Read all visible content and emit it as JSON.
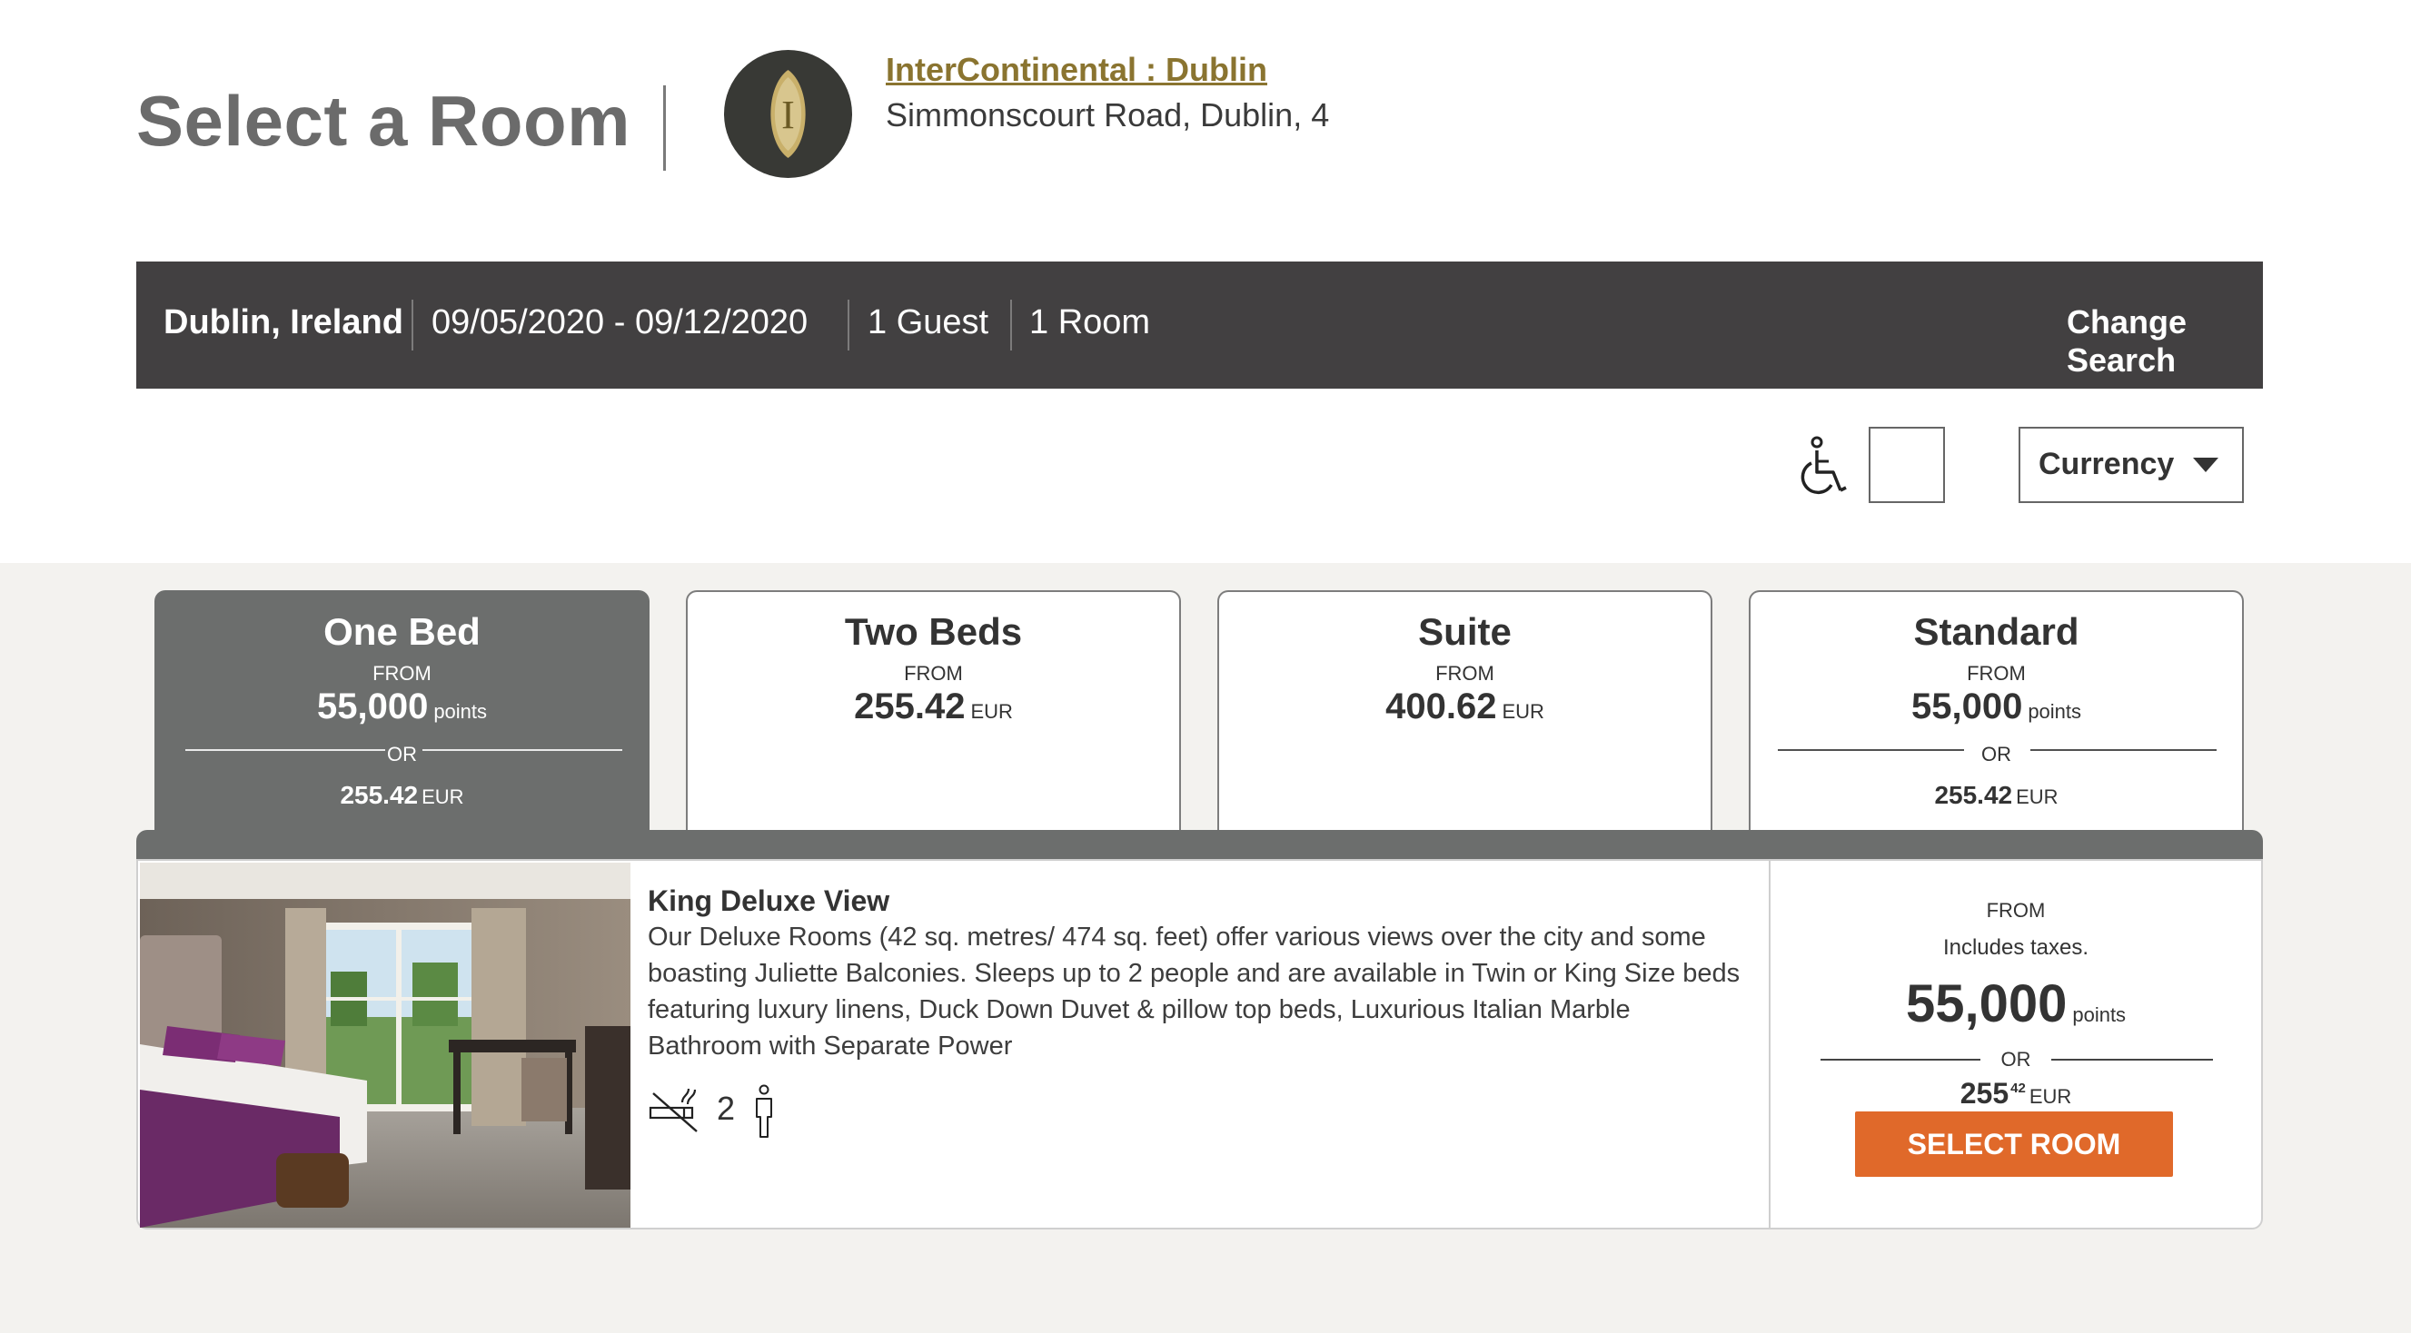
{
  "header": {
    "title": "Select a Room",
    "hotel_name": "InterContinental : Dublin",
    "hotel_address": "Simmonscourt Road, Dublin, 4",
    "logo_letter": "I"
  },
  "search_bar": {
    "location": "Dublin, Ireland",
    "dates": "09/05/2020 - 09/12/2020",
    "guests": "1 Guest",
    "rooms": "1 Room",
    "change_search_label": "Change Search"
  },
  "filters": {
    "currency_label": "Currency",
    "accessible_checked": false
  },
  "tabs": [
    {
      "name": "One Bed",
      "from": "FROM",
      "price": "55,000",
      "unit": "points",
      "or": "OR",
      "alt_price": "255.42",
      "alt_unit": "EUR",
      "active": true
    },
    {
      "name": "Two Beds",
      "from": "FROM",
      "price": "255.42",
      "unit": "EUR",
      "active": false
    },
    {
      "name": "Suite",
      "from": "FROM",
      "price": "400.62",
      "unit": "EUR",
      "active": false
    },
    {
      "name": "Standard",
      "from": "FROM",
      "price": "55,000",
      "unit": "points",
      "or": "OR",
      "alt_price": "255.42",
      "alt_unit": "EUR",
      "active": false
    }
  ],
  "room": {
    "name": "King Deluxe View",
    "description": "Our Deluxe Rooms (42 sq. metres/ 474 sq. feet) offer various views over the city and some boasting Juliette Balconies. Sleeps up to 2 people and are available in Twin or King Size beds featuring luxury linens, Duck Down Duvet & pillow top beds, Luxurious Italian Marble Bathroom with Separate Power",
    "occupancy": "2",
    "price": {
      "from": "FROM",
      "taxes_note": "Includes taxes.",
      "points": "55,000",
      "points_unit": "points",
      "or": "OR",
      "alt_whole": "255",
      "alt_cents": "42",
      "alt_unit": "EUR"
    },
    "select_label": "SELECT ROOM"
  },
  "colors": {
    "brand_gold": "#8a7430",
    "search_bar_bg": "#424041",
    "active_tab_bg": "#6c6e6d",
    "cta_orange": "#e0692a",
    "content_bg": "#f3f2ef"
  },
  "icons": [
    "hotel-logo-icon",
    "chevron-down-icon",
    "wheelchair-icon",
    "caret-down-icon",
    "no-smoking-icon",
    "person-icon"
  ]
}
